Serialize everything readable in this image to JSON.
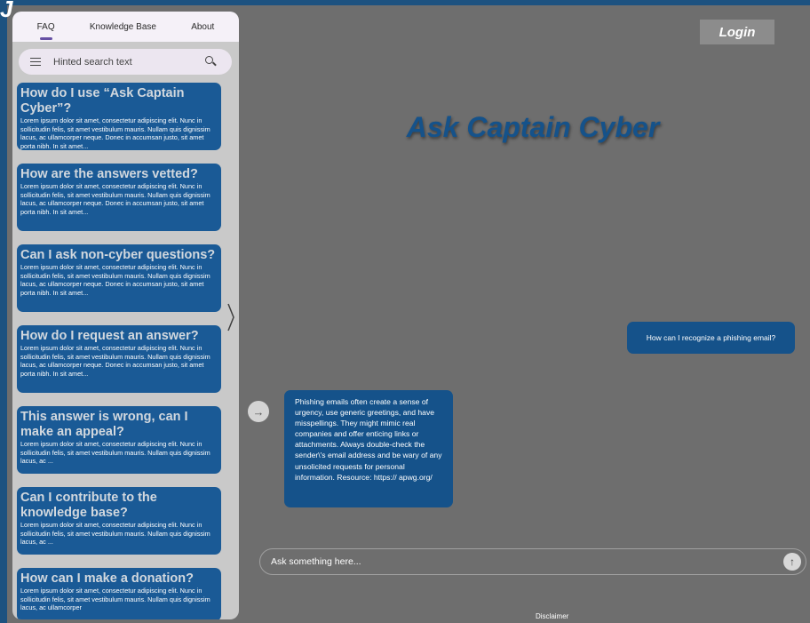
{
  "corner_glyph": "J",
  "tabs": [
    {
      "label": "FAQ",
      "active": true
    },
    {
      "label": "Knowledge Base",
      "active": false
    },
    {
      "label": "About",
      "active": false
    }
  ],
  "search": {
    "placeholder": "Hinted search text"
  },
  "faq_items": [
    {
      "title": "How do I use “Ask Captain Cyber”?",
      "body": "Lorem ipsum dolor sit amet, consectetur adipiscing elit. Nunc in sollicitudin felis, sit amet vestibulum mauris. Nullam quis dignissim lacus, ac ullamcorper neque. Donec in accumsan justo, sit amet  porta nibh. In sit amet..."
    },
    {
      "title": "How are the answers vetted?",
      "body": "Lorem ipsum dolor sit amet, consectetur adipiscing elit. Nunc in sollicitudin felis, sit amet vestibulum mauris. Nullam quis dignissim lacus, ac ullamcorper neque. Donec in accumsan justo, sit amet  porta nibh. In sit amet..."
    },
    {
      "title": "Can I ask non-cyber questions?",
      "body": "Lorem ipsum dolor sit amet, consectetur adipiscing elit. Nunc in sollicitudin felis, sit amet vestibulum mauris. Nullam quis dignissim lacus, ac ullamcorper neque. Donec in accumsan justo, sit amet  porta nibh. In sit amet..."
    },
    {
      "title": "How do I request an answer?",
      "body": "Lorem ipsum dolor sit amet, consectetur adipiscing elit. Nunc in sollicitudin felis, sit amet vestibulum mauris. Nullam quis dignissim lacus, ac ullamcorper neque. Donec in accumsan justo, sit amet  porta nibh. In sit amet..."
    },
    {
      "title": "This answer is wrong, can I make an appeal?",
      "body": " Lorem ipsum dolor sit amet, consectetur adipiscing  elit. Nunc in sollicitudin felis, sit amet vestibulum  mauris. Nullam quis dignissim lacus, ac  ..."
    },
    {
      "title": "Can I contribute to the knowledge base?",
      "body": " Lorem ipsum dolor sit amet, consectetur adipiscing  elit. Nunc in sollicitudin felis, sit amet vestibulum  mauris. Nullam quis dignissim lacus, ac  ..."
    },
    {
      "title": "How can I make a donation?",
      "body": " Lorem ipsum dolor sit amet, consectetur adipiscing  elit. Nunc in sollicitudin felis, sit amet vestibulum  mauris. Nullam quis dignissim lacus, ac ullamcorper"
    }
  ],
  "login_label": "Login",
  "app_title": "Ask Captain Cyber",
  "chat": {
    "user_message": "How can I recognize a phishing email?",
    "bot_message": "Phishing emails often create a sense of urgency, use generic greetings, and have misspellings. They might mimic real companies and offer enticing links or attachments. Always double-check the sender\\'s email address and be wary of any unsolicited requests for personal information. Resource: https:// apwg.org/"
  },
  "ask_input": {
    "placeholder": "Ask something here..."
  },
  "disclaimer": "Disclaimer",
  "colors": {
    "frame": "#1d5280",
    "background": "#6e6e6e",
    "accent": "#15528a",
    "card": "#1a5a96",
    "sidebar": "#c9c9c9",
    "tab_bar": "#f5f1f8",
    "active_indicator": "#6650a4"
  },
  "icons": {
    "menu": "menu-icon",
    "search": "search-icon",
    "chevron": "chevron-right-icon",
    "reply": "arrow-right-icon",
    "send": "arrow-up-icon"
  }
}
